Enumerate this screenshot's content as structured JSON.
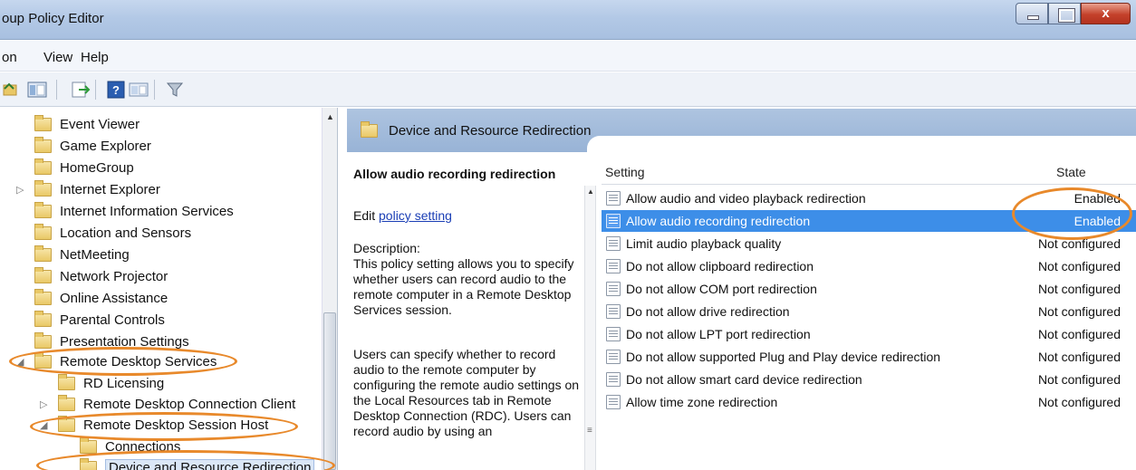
{
  "window": {
    "title": "oup Policy Editor",
    "close_glyph": "x"
  },
  "menu": [
    "on",
    "View",
    "Help"
  ],
  "tree": {
    "items": [
      {
        "label": "Event Viewer",
        "expander": ""
      },
      {
        "label": "Game Explorer",
        "expander": ""
      },
      {
        "label": "HomeGroup",
        "expander": ""
      },
      {
        "label": "Internet Explorer",
        "expander": "▷"
      },
      {
        "label": "Internet Information Services",
        "expander": ""
      },
      {
        "label": "Location and Sensors",
        "expander": ""
      },
      {
        "label": "NetMeeting",
        "expander": ""
      },
      {
        "label": "Network Projector",
        "expander": ""
      },
      {
        "label": "Online Assistance",
        "expander": ""
      },
      {
        "label": "Parental Controls",
        "expander": ""
      },
      {
        "label": "Presentation Settings",
        "expander": ""
      },
      {
        "label": "Remote Desktop Services",
        "expander": "◢"
      },
      {
        "label": "RD Licensing",
        "expander": ""
      },
      {
        "label": "Remote Desktop Connection Client",
        "expander": "▷"
      },
      {
        "label": "Remote Desktop Session Host",
        "expander": "◢"
      },
      {
        "label": "Connections",
        "expander": ""
      },
      {
        "label": "Device and Resource Redirection",
        "expander": ""
      }
    ]
  },
  "right": {
    "header_title": "Device and Resource Redirection",
    "policy_title": "Allow audio recording redirection",
    "edit_prefix": "Edit ",
    "edit_link": "policy setting ",
    "description_label": "Description:",
    "description_p1": "This policy setting allows you to specify whether users can record audio to the remote computer in a Remote Desktop Services session.",
    "description_p2": "Users can specify whether to record audio to the remote computer by configuring the remote audio settings on the Local Resources tab in Remote Desktop Connection (RDC). Users can record audio by using an",
    "columns": {
      "setting": "Setting",
      "state": "State"
    },
    "rows": [
      {
        "name": "Allow audio and video playback redirection",
        "state": "Enabled"
      },
      {
        "name": "Allow audio recording redirection",
        "state": "Enabled"
      },
      {
        "name": "Limit audio playback quality",
        "state": "Not configured"
      },
      {
        "name": "Do not allow clipboard redirection",
        "state": "Not configured"
      },
      {
        "name": "Do not allow COM port redirection",
        "state": "Not configured"
      },
      {
        "name": "Do not allow drive redirection",
        "state": "Not configured"
      },
      {
        "name": "Do not allow LPT port redirection",
        "state": "Not configured"
      },
      {
        "name": "Do not allow supported Plug and Play device redirection",
        "state": "Not configured"
      },
      {
        "name": "Do not allow smart card device redirection",
        "state": "Not configured"
      },
      {
        "name": "Allow time zone redirection",
        "state": "Not configured"
      }
    ],
    "selected_row": 1
  },
  "colors": {
    "annotation": "#e8892b",
    "selection": "#3d8ee8",
    "link": "#1a3eb5"
  }
}
